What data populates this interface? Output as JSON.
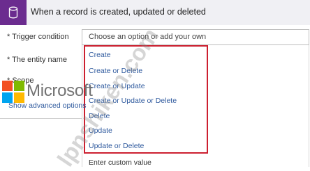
{
  "header": {
    "title": "When a record is created, updated or deleted",
    "icon": "database-icon",
    "icon_color": "#6b2c8f"
  },
  "form": {
    "trigger_label": "* Trigger condition",
    "trigger_placeholder": "Choose an option or add your own",
    "entity_label": "* The entity name",
    "scope_label": "* Scope",
    "advanced_link": "Show advanced options"
  },
  "dropdown": {
    "options": [
      "Create",
      "Create or Delete",
      "Create or Update",
      "Create or Update or Delete",
      "Delete",
      "Update",
      "Update or Delete"
    ],
    "custom_value": "Enter custom value",
    "highlight_color": "#cc1f2f"
  },
  "overlay": {
    "logo_text": "Microsoft",
    "watermark": "lpnshiken.com"
  }
}
